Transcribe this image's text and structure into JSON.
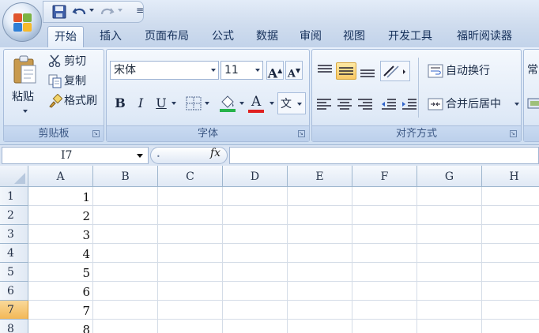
{
  "window": {
    "quick_access": [
      "save-icon",
      "undo-icon",
      "redo-icon",
      "customize-icon"
    ],
    "office_button": "office-button"
  },
  "tabs": [
    {
      "label": "开始",
      "active": true
    },
    {
      "label": "插入"
    },
    {
      "label": "页面布局"
    },
    {
      "label": "公式"
    },
    {
      "label": "数据"
    },
    {
      "label": "审阅"
    },
    {
      "label": "视图"
    },
    {
      "label": "开发工具"
    },
    {
      "label": "福昕阅读器"
    }
  ],
  "ribbon": {
    "clipboard": {
      "group_label": "剪贴板",
      "paste_label": "粘贴",
      "cut_label": "剪切",
      "copy_label": "复制",
      "format_painter_label": "格式刷"
    },
    "font": {
      "group_label": "字体",
      "font_name": "宋体",
      "font_size": "11",
      "bold": "B",
      "italic": "I",
      "underline": "U",
      "grow_font": "A",
      "shrink_font": "A",
      "font_color_accent": "#e02020",
      "fill_color_accent": "#26b34a"
    },
    "alignment": {
      "group_label": "对齐方式",
      "wrap_text_label": "自动换行",
      "merge_center_label": "合并后居中"
    },
    "number": {
      "format_partial": "常"
    }
  },
  "formula_bar": {
    "name_box": "I7",
    "fx_label": "fx",
    "formula": ""
  },
  "sheet": {
    "columns": [
      "A",
      "B",
      "C",
      "D",
      "E",
      "F",
      "G",
      "H"
    ],
    "rows": [
      "1",
      "2",
      "3",
      "4",
      "5",
      "6",
      "7",
      "8"
    ],
    "selected_row": "7",
    "column_a_values": [
      "1",
      "2",
      "3",
      "4",
      "5",
      "6",
      "7",
      "8"
    ]
  }
}
